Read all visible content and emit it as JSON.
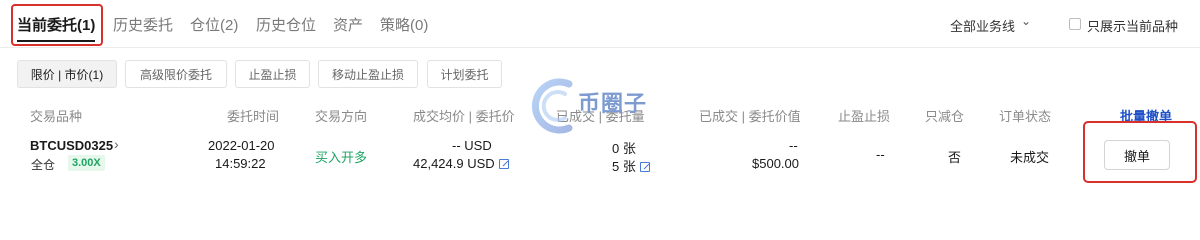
{
  "tabs": [
    {
      "label": "当前委托(1)",
      "active": true
    },
    {
      "label": "历史委托"
    },
    {
      "label": "仓位(2)"
    },
    {
      "label": "历史仓位"
    },
    {
      "label": "资产"
    },
    {
      "label": "策略(0)"
    }
  ],
  "filter": {
    "label": "全部业务线",
    "checkbox_label": "只展示当前品种"
  },
  "subtabs": [
    "限价 | 市价(1)",
    "高级限价委托",
    "止盈止损",
    "移动止盈止损",
    "计划委托"
  ],
  "columns": [
    "交易品种",
    "委托时间",
    "交易方向",
    "成交均价 | 委托价",
    "已成交 | 委托量",
    "已成交 | 委托价值",
    "止盈止损",
    "只减仓",
    "订单状态"
  ],
  "bulk_cancel_label": "批量撤单",
  "order": {
    "symbol": "BTCUSD0325",
    "margin_mode": "全仓",
    "leverage": "3.00X",
    "date": "2022-01-20",
    "time": "14:59:22",
    "side": "买入开多",
    "avg_price": "-- USD",
    "order_price": "42,424.9 USD",
    "filled_qty": "0 张",
    "order_qty": "5 张",
    "filled_value": "--",
    "order_value": "$500.00",
    "tp_sl": "--",
    "reduce_only": "否",
    "status": "未成交",
    "cancel_label": "撤单"
  },
  "watermark": "币圈子",
  "colors": {
    "accent_green": "#1fa463",
    "link_blue": "#1e50c8",
    "highlight_red": "#d9302c"
  }
}
